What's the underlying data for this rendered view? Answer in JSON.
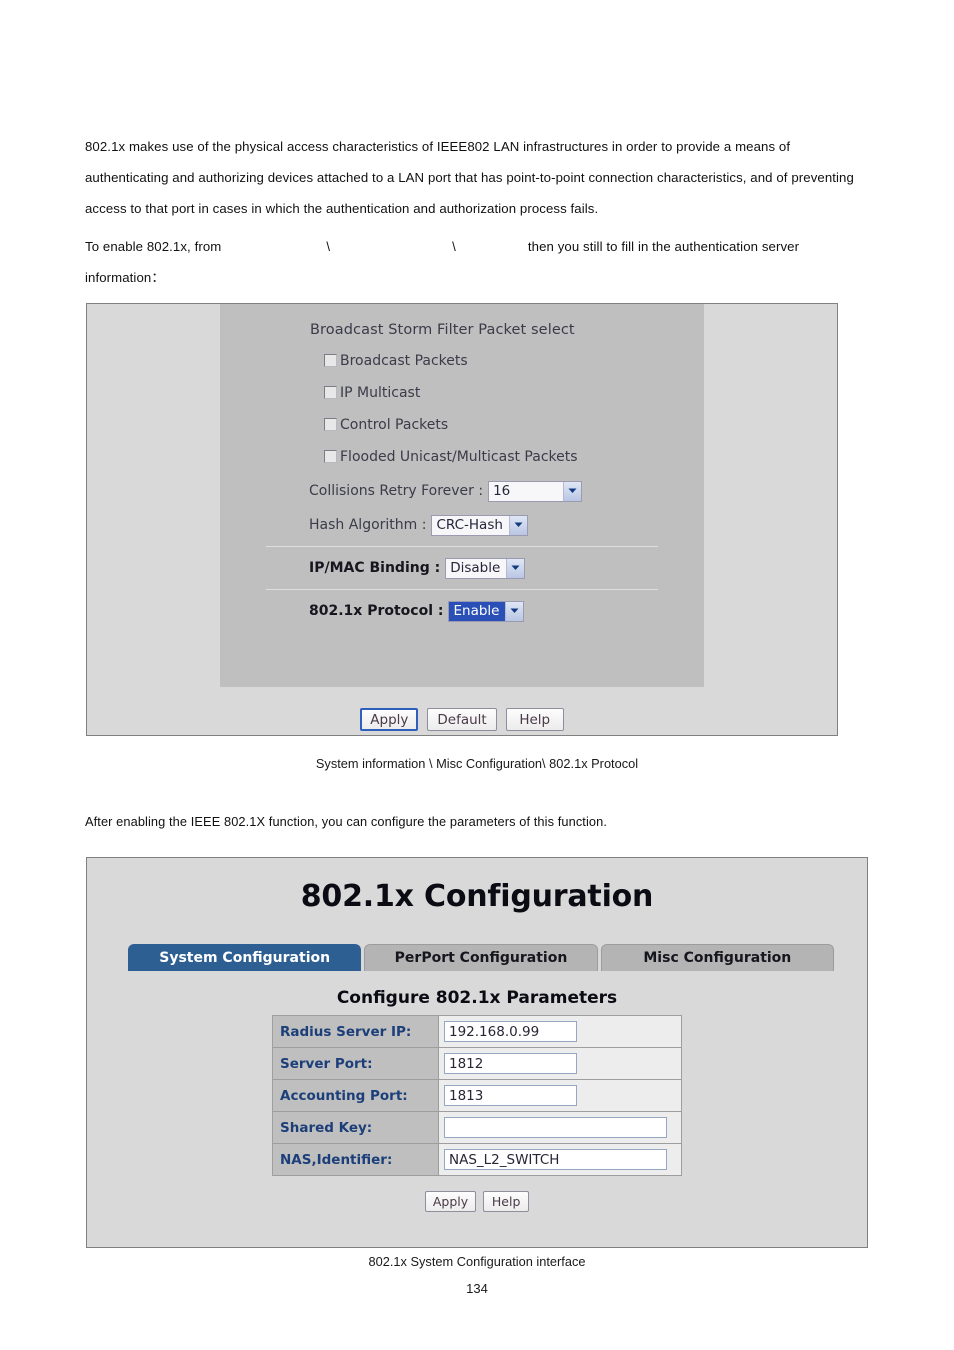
{
  "page": {
    "number": "134"
  },
  "prose": {
    "intro": "802.1x makes use of the physical access characteristics of IEEE802 LAN infrastructures in order to provide a means of authenticating and authorizing devices attached to a LAN port that has point-to-point connection characteristics, and of preventing access to that port in cases in which the authentication and authorization process fails.",
    "enable_part1": "To enable 802.1x, from",
    "enable_sep1": "\\",
    "enable_sep2": "\\",
    "enable_part2": "then you still to fill in the authentication server information：",
    "after_enable": "After enabling the IEEE 802.1X function, you can configure the parameters of this function."
  },
  "misc_screenshot": {
    "heading": "Broadcast Storm Filter Packet select",
    "checkboxes": [
      {
        "label": "Broadcast Packets",
        "checked": false
      },
      {
        "label": "IP Multicast",
        "checked": false
      },
      {
        "label": "Control Packets",
        "checked": false
      },
      {
        "label": "Flooded Unicast/Multicast Packets",
        "checked": false
      }
    ],
    "selects": [
      {
        "label": "Collisions Retry Forever :",
        "value": "16",
        "bold": false,
        "highlighted": false
      },
      {
        "label": "Hash Algorithm :",
        "value": "CRC-Hash",
        "bold": false,
        "highlighted": false
      },
      {
        "label": "IP/MAC Binding :",
        "value": "Disable",
        "bold": true,
        "highlighted": false
      },
      {
        "label": "802.1x Protocol :",
        "value": "Enable",
        "bold": true,
        "highlighted": true
      }
    ],
    "buttons": {
      "apply": "Apply",
      "default": "Default",
      "help": "Help"
    },
    "caption": "System information \\ Misc Configuration\\ 802.1x Protocol",
    "colors": {
      "outer_background": "#d9d9d9",
      "inner_background": "#bfbfbf",
      "selection_highlight": "#2a50b8",
      "focus_border": "#2f5fbd"
    }
  },
  "dot1x_screenshot": {
    "title": "802.1x Configuration",
    "tabs": [
      {
        "label": "System Configuration",
        "active": true
      },
      {
        "label": "PerPort Configuration",
        "active": false
      },
      {
        "label": "Misc Configuration",
        "active": false
      }
    ],
    "subtitle": "Configure 802.1x Parameters",
    "fields": [
      {
        "label": "Radius Server IP:",
        "value": "192.168.0.99",
        "width": "short"
      },
      {
        "label": "Server Port:",
        "value": "1812",
        "width": "short"
      },
      {
        "label": "Accounting Port:",
        "value": "1813",
        "width": "short"
      },
      {
        "label": "Shared Key:",
        "value": "",
        "width": "long"
      },
      {
        "label": "NAS,Identifier:",
        "value": "NAS_L2_SWITCH",
        "width": "long"
      }
    ],
    "buttons": {
      "apply": "Apply",
      "help": "Help"
    },
    "caption": "802.1x System Configuration interface",
    "colors": {
      "background": "#d9d9d9",
      "active_tab": "#2d5f93",
      "inactive_tab": "#b4b4b4",
      "label_text": "#1c3f7a",
      "label_cell": "#bfbfbf"
    }
  }
}
